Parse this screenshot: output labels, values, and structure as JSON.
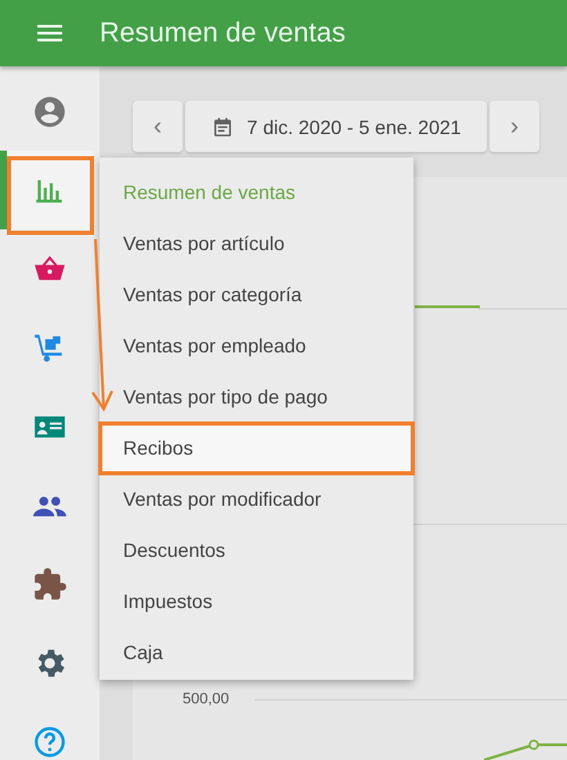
{
  "app_bar": {
    "title": "Resumen de ventas"
  },
  "sidebar": {
    "items": [
      {
        "kind": "profile",
        "color": "#757575",
        "selected": false
      },
      {
        "kind": "reports",
        "color": "#4caf50",
        "selected": true
      },
      {
        "kind": "basket",
        "color": "#d81b60",
        "selected": false
      },
      {
        "kind": "dolly",
        "color": "#1e88e5",
        "selected": false
      },
      {
        "kind": "card",
        "color": "#00897b",
        "selected": false
      },
      {
        "kind": "people",
        "color": "#3f51b5",
        "selected": false
      },
      {
        "kind": "puzzle",
        "color": "#795548",
        "selected": false
      },
      {
        "kind": "gear",
        "color": "#455a64",
        "selected": false
      },
      {
        "kind": "help",
        "color": "#039be5",
        "selected": false
      }
    ]
  },
  "date_range": {
    "prev": "‹",
    "label": "7 dic. 2020 - 5 ene. 2021",
    "next": "›"
  },
  "chart": {
    "axis_label": "500,00"
  },
  "menu": {
    "items": [
      {
        "label": "Resumen de ventas",
        "selected": true,
        "highlighted": false
      },
      {
        "label": "Ventas por artículo",
        "selected": false,
        "highlighted": false
      },
      {
        "label": "Ventas por categoría",
        "selected": false,
        "highlighted": false
      },
      {
        "label": "Ventas por empleado",
        "selected": false,
        "highlighted": false
      },
      {
        "label": "Ventas por tipo de pago",
        "selected": false,
        "highlighted": false
      },
      {
        "label": "Recibos",
        "selected": false,
        "highlighted": true
      },
      {
        "label": "Ventas por modificador",
        "selected": false,
        "highlighted": false
      },
      {
        "label": "Descuentos",
        "selected": false,
        "highlighted": false
      },
      {
        "label": "Impuestos",
        "selected": false,
        "highlighted": false
      },
      {
        "label": "Caja",
        "selected": false,
        "highlighted": false
      }
    ]
  }
}
